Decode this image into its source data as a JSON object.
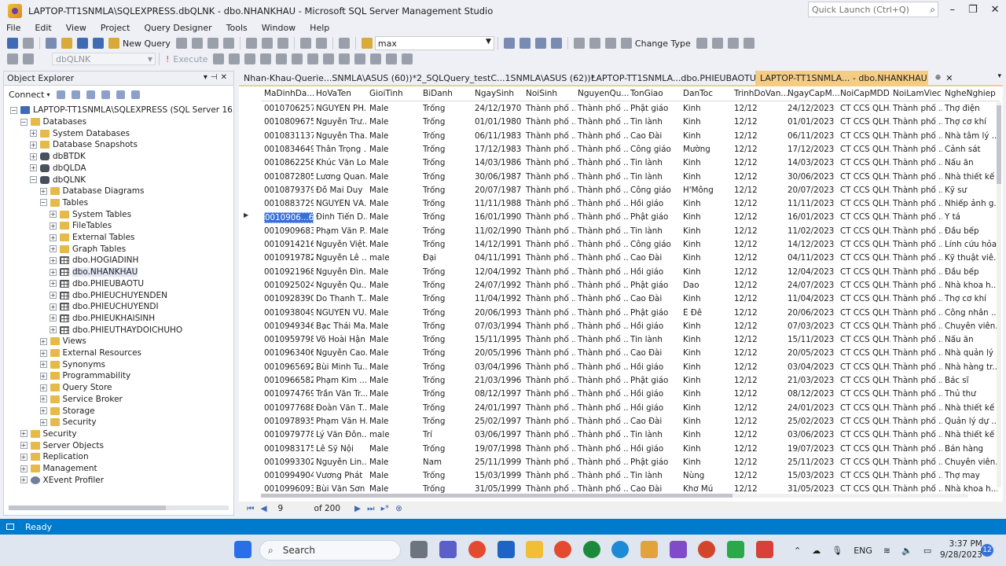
{
  "window": {
    "title": "LAPTOP-TT1SNMLA\\SQLEXPRESS.dbQLNK - dbo.NHANKHAU - Microsoft SQL Server Management Studio",
    "quick_launch_placeholder": "Quick Launch (Ctrl+Q)"
  },
  "menu": [
    "File",
    "Edit",
    "View",
    "Project",
    "Query Designer",
    "Tools",
    "Window",
    "Help"
  ],
  "toolbar": {
    "new_query": "New Query",
    "combo_value": "max",
    "change_type": "Change Type",
    "execute": "Execute",
    "db_selector": "dbQLNK"
  },
  "object_explorer": {
    "title": "Object Explorer",
    "connect": "Connect",
    "tree": [
      {
        "label": "LAPTOP-TT1SNMLA\\SQLEXPRESS (SQL Server 16.0.1000 - LA",
        "level": 0,
        "icon": "server",
        "exp": "−"
      },
      {
        "label": "Databases",
        "level": 1,
        "icon": "folder",
        "exp": "−"
      },
      {
        "label": "System Databases",
        "level": 2,
        "icon": "folder",
        "exp": "+"
      },
      {
        "label": "Database Snapshots",
        "level": 2,
        "icon": "folder",
        "exp": "+"
      },
      {
        "label": "dbBTDK",
        "level": 2,
        "icon": "db",
        "exp": "+"
      },
      {
        "label": "dbQLDA",
        "level": 2,
        "icon": "db",
        "exp": "+"
      },
      {
        "label": "dbQLNK",
        "level": 2,
        "icon": "db",
        "exp": "−"
      },
      {
        "label": "Database Diagrams",
        "level": 3,
        "icon": "folder",
        "exp": "+"
      },
      {
        "label": "Tables",
        "level": 3,
        "icon": "folder",
        "exp": "−"
      },
      {
        "label": "System Tables",
        "level": 4,
        "icon": "folder",
        "exp": "+"
      },
      {
        "label": "FileTables",
        "level": 4,
        "icon": "folder",
        "exp": "+"
      },
      {
        "label": "External Tables",
        "level": 4,
        "icon": "folder",
        "exp": "+"
      },
      {
        "label": "Graph Tables",
        "level": 4,
        "icon": "folder",
        "exp": "+"
      },
      {
        "label": "dbo.HOGIADINH",
        "level": 4,
        "icon": "table",
        "exp": "+"
      },
      {
        "label": "dbo.NHANKHAU",
        "level": 4,
        "icon": "table",
        "exp": "+",
        "selected": true
      },
      {
        "label": "dbo.PHIEUBAOTU",
        "level": 4,
        "icon": "table",
        "exp": "+"
      },
      {
        "label": "dbo.PHIEUCHUYENDEN",
        "level": 4,
        "icon": "table",
        "exp": "+"
      },
      {
        "label": "dbo.PHIEUCHUYENDI",
        "level": 4,
        "icon": "table",
        "exp": "+"
      },
      {
        "label": "dbo.PHIEUKHAISINH",
        "level": 4,
        "icon": "table",
        "exp": "+"
      },
      {
        "label": "dbo.PHIEUTHAYDOICHUHO",
        "level": 4,
        "icon": "table",
        "exp": "+"
      },
      {
        "label": "Views",
        "level": 3,
        "icon": "folder",
        "exp": "+"
      },
      {
        "label": "External Resources",
        "level": 3,
        "icon": "folder",
        "exp": "+"
      },
      {
        "label": "Synonyms",
        "level": 3,
        "icon": "folder",
        "exp": "+"
      },
      {
        "label": "Programmability",
        "level": 3,
        "icon": "folder",
        "exp": "+"
      },
      {
        "label": "Query Store",
        "level": 3,
        "icon": "folder",
        "exp": "+"
      },
      {
        "label": "Service Broker",
        "level": 3,
        "icon": "folder",
        "exp": "+"
      },
      {
        "label": "Storage",
        "level": 3,
        "icon": "folder",
        "exp": "+"
      },
      {
        "label": "Security",
        "level": 3,
        "icon": "folder",
        "exp": "+"
      },
      {
        "label": "Security",
        "level": 1,
        "icon": "folder",
        "exp": "+"
      },
      {
        "label": "Server Objects",
        "level": 1,
        "icon": "folder",
        "exp": "+"
      },
      {
        "label": "Replication",
        "level": 1,
        "icon": "folder",
        "exp": "+"
      },
      {
        "label": "Management",
        "level": 1,
        "icon": "folder",
        "exp": "+"
      },
      {
        "label": "XEvent Profiler",
        "level": 1,
        "icon": "gear",
        "exp": "+"
      }
    ]
  },
  "tabs": [
    {
      "label": "Nhan-Khau-Querie...SNMLA\\ASUS (60))*",
      "active": false
    },
    {
      "label": "2_SQLQuery_testC...1SNMLA\\ASUS (62))*",
      "active": false
    },
    {
      "label": "LAPTOP-TT1SNMLA...dbo.PHIEUBAOTU",
      "active": false
    },
    {
      "label": "LAPTOP-TT1SNMLA... - dbo.NHANKHAU",
      "active": true
    }
  ],
  "grid": {
    "columns": [
      "MaDinhDa...",
      "HoVaTen",
      "GioiTinh",
      "BiDanh",
      "NgaySinh",
      "NoiSinh",
      "NguyenQu...",
      "TonGiao",
      "DanToc",
      "TrinhDoVan...",
      "NgayCapM...",
      "NoiCapMDD",
      "NoiLamViec",
      "NgheNghiep"
    ],
    "rows": [
      [
        "0010706257...",
        "NGUYỄN PH...",
        "Male",
        "Trống",
        "24/12/1970",
        "Thành phố ...",
        "Thành phố ...",
        "Phật giáo",
        "Kinh",
        "12/12",
        "24/12/2023",
        "CT CCS QLH...",
        "Thành phố ...",
        "Thợ điện"
      ],
      [
        "0010809675...",
        "Nguyễn Trư...",
        "Male",
        "Trống",
        "01/01/1980",
        "Thành phố ...",
        "Thành phố ...",
        "Tin lành",
        "Kinh",
        "12/12",
        "01/01/2023",
        "CT CCS QLH...",
        "Thành phố ...",
        "Thợ cơ khí"
      ],
      [
        "0010831137...",
        "Nguyễn Tha...",
        "Male",
        "Trống",
        "06/11/1983",
        "Thành phố ...",
        "Thành phố ...",
        "Cao Đài",
        "Kinh",
        "12/12",
        "06/11/2023",
        "CT CCS QLH...",
        "Thành phố ...",
        "Nhà tâm lý ..."
      ],
      [
        "0010834649...",
        "Thân Trọng ...",
        "Male",
        "Trống",
        "17/12/1983",
        "Thành phố ...",
        "Thành phố ...",
        "Công giáo",
        "Mường",
        "12/12",
        "17/12/2023",
        "CT CCS QLH...",
        "Thành phố ...",
        "Cảnh sát"
      ],
      [
        "0010862258...",
        "Khúc Văn Lo...",
        "Male",
        "Trống",
        "14/03/1986",
        "Thành phố ...",
        "Thành phố ...",
        "Tin lành",
        "Kinh",
        "12/12",
        "14/03/2023",
        "CT CCS QLH...",
        "Thành phố ...",
        "Nấu ăn"
      ],
      [
        "0010872805...",
        "Lương Quan...",
        "Male",
        "Trống",
        "30/06/1987",
        "Thành phố ...",
        "Thành phố ...",
        "Tin lành",
        "Kinh",
        "12/12",
        "30/06/2023",
        "CT CCS QLH...",
        "Thành phố ...",
        "Nhà thiết kế ..."
      ],
      [
        "0010879379...",
        "Đỗ Mai Duy",
        "Male",
        "Trống",
        "20/07/1987",
        "Thành phố ...",
        "Thành phố ...",
        "Công giáo",
        "H'Mông",
        "12/12",
        "20/07/2023",
        "CT CCS QLH...",
        "Thành phố ...",
        "Kỹ sư"
      ],
      [
        "0010883729...",
        "NGUYỄN VĂ...",
        "Male",
        "Trống",
        "11/11/1988",
        "Thành phố ...",
        "Thành phố ...",
        "Hồi giáo",
        "Kinh",
        "12/12",
        "11/11/2023",
        "CT CCS QLH...",
        "Thành phố ...",
        "Nhiếp ảnh g..."
      ],
      [
        "0010906...682",
        "Đinh Tiến D...",
        "Male",
        "Trống",
        "16/01/1990",
        "Thành phố ...",
        "Thành phố ...",
        "Phật giáo",
        "Kinh",
        "12/12",
        "16/01/2023",
        "CT CCS QLH...",
        "Thành phố ...",
        "Y tá"
      ],
      [
        "0010909683...",
        "Phạm Văn P...",
        "Male",
        "Trống",
        "11/02/1990",
        "Thành phố ...",
        "Thành phố ...",
        "Tin lành",
        "Kinh",
        "12/12",
        "11/02/2023",
        "CT CCS QLH...",
        "Thành phố ...",
        "Đầu bếp"
      ],
      [
        "0010914216...",
        "Nguyễn Việt...",
        "Male",
        "Trống",
        "14/12/1991",
        "Thành phố ...",
        "Thành phố ...",
        "Công giáo",
        "Kinh",
        "12/12",
        "14/12/2023",
        "CT CCS QLH...",
        "Thành phố ...",
        "Lính cứu hỏa"
      ],
      [
        "0010919782...",
        "Nguyễn Lê ...",
        "male",
        "Đại",
        "04/11/1991",
        "Thành phố ...",
        "Thành phố ...",
        "Cao Đài",
        "Kinh",
        "12/12",
        "04/11/2023",
        "CT CCS QLH...",
        "Thành phố ...",
        "Kỹ thuật viê..."
      ],
      [
        "0010921968...",
        "Nguyễn Đìn...",
        "Male",
        "Trống",
        "12/04/1992",
        "Thành phố ...",
        "Thành phố ...",
        "Hồi giáo",
        "Kinh",
        "12/12",
        "12/04/2023",
        "CT CCS QLH...",
        "Thành phố ...",
        "Đầu bếp"
      ],
      [
        "0010925024...",
        "Nguyễn Qu...",
        "Male",
        "Trống",
        "24/07/1992",
        "Thành phố ...",
        "Thành phố ...",
        "Phật giáo",
        "Dao",
        "12/12",
        "24/07/2023",
        "CT CCS QLH...",
        "Thành phố ...",
        "Nhà khoa h..."
      ],
      [
        "0010928390...",
        "Do Thanh T...",
        "Male",
        "Trống",
        "11/04/1992",
        "Thành phố ...",
        "Thành phố ...",
        "Cao Đài",
        "Kinh",
        "12/12",
        "11/04/2023",
        "CT CCS QLH...",
        "Thành phố ...",
        "Thợ cơ khí"
      ],
      [
        "0010938049...",
        "NGUYỄN VŨ...",
        "Male",
        "Trống",
        "20/06/1993",
        "Thành phố ...",
        "Thành phố ...",
        "Phật giáo",
        "Ê Đê",
        "12/12",
        "20/06/2023",
        "CT CCS QLH...",
        "Thành phố ...",
        "Công nhân ..."
      ],
      [
        "0010949346...",
        "Bạc Thái Ma...",
        "Male",
        "Trống",
        "07/03/1994",
        "Thành phố ...",
        "Thành phố ...",
        "Hồi giáo",
        "Kinh",
        "12/12",
        "07/03/2023",
        "CT CCS QLH...",
        "Thành phố ...",
        "Chuyên viên..."
      ],
      [
        "0010959798...",
        "Võ Hoài Hận",
        "Male",
        "Trống",
        "15/11/1995",
        "Thành phố ...",
        "Thành phố ...",
        "Tin lành",
        "Kinh",
        "12/12",
        "15/11/2023",
        "CT CCS QLH...",
        "Thành phố ...",
        "Nấu ăn"
      ],
      [
        "0010963406...",
        "Nguyễn Cao...",
        "Male",
        "Trống",
        "20/05/1996",
        "Thành phố ...",
        "Thành phố ...",
        "Cao Đài",
        "Kinh",
        "12/12",
        "20/05/2023",
        "CT CCS QLH...",
        "Thành phố ...",
        "Nhà quản lý"
      ],
      [
        "0010965692...",
        "Bùi Minh Tu...",
        "Male",
        "Trống",
        "03/04/1996",
        "Thành phố ...",
        "Thành phố ...",
        "Hồi giáo",
        "Kinh",
        "12/12",
        "03/04/2023",
        "CT CCS QLH...",
        "Thành phố ...",
        "Nhà hàng tr..."
      ],
      [
        "0010966582...",
        "Phạm Kim ...",
        "Male",
        "Trống",
        "21/03/1996",
        "Thành phố ...",
        "Thành phố ...",
        "Phật giáo",
        "Kinh",
        "12/12",
        "21/03/2023",
        "CT CCS QLH...",
        "Thành phố ...",
        "Bác sĩ"
      ],
      [
        "0010974769...",
        "Trần Văn Tr...",
        "Male",
        "Trống",
        "08/12/1997",
        "Thành phố ...",
        "Thành phố ...",
        "Hồi giáo",
        "Kinh",
        "12/12",
        "08/12/2023",
        "CT CCS QLH...",
        "Thành phố ...",
        "Thủ thư"
      ],
      [
        "0010977688...",
        "Đoàn Văn T...",
        "Male",
        "Trống",
        "24/01/1997",
        "Thành phố ...",
        "Thành phố ...",
        "Hồi giáo",
        "Kinh",
        "12/12",
        "24/01/2023",
        "CT CCS QLH...",
        "Thành phố ...",
        "Nhà thiết kế ..."
      ],
      [
        "0010978935...",
        "Phạm Văn H...",
        "Male",
        "Trống",
        "25/02/1997",
        "Thành phố ...",
        "Thành phố ...",
        "Cao Đài",
        "Kinh",
        "12/12",
        "25/02/2023",
        "CT CCS QLH...",
        "Thành phố ...",
        "Quản lý dự ..."
      ],
      [
        "0010979778...",
        "Lý Văn Đôn...",
        "male",
        "Trí",
        "03/06/1997",
        "Thành phố ...",
        "Thành phố ...",
        "Tin lành",
        "Kinh",
        "12/12",
        "03/06/2023",
        "CT CCS QLH...",
        "Thành phố ...",
        "Nhà thiết kế ..."
      ],
      [
        "0010983175...",
        "Lê Sỹ Nội",
        "Male",
        "Trống",
        "19/07/1998",
        "Thành phố ...",
        "Thành phố ...",
        "Hồi giáo",
        "Kinh",
        "12/12",
        "19/07/2023",
        "CT CCS QLH...",
        "Thành phố ...",
        "Bán hàng"
      ],
      [
        "0010993302...",
        "Nguyễn Lin...",
        "Male",
        "Nam",
        "25/11/1999",
        "Thành phố ...",
        "Thành phố ...",
        "Phật giáo",
        "Kinh",
        "12/12",
        "25/11/2023",
        "CT CCS QLH...",
        "Thành phố ...",
        "Chuyên viên..."
      ],
      [
        "0010994904...",
        "Vương Phát",
        "Male",
        "Trống",
        "15/03/1999",
        "Thành phố ...",
        "Thành phố ...",
        "Tin lành",
        "Nùng",
        "12/12",
        "15/03/2023",
        "CT CCS QLH...",
        "Thành phố ...",
        "Thợ may"
      ],
      [
        "0010996093...",
        "Bùi Văn Sơn",
        "Male",
        "Trống",
        "31/05/1999",
        "Thành phố ...",
        "Thành phố ...",
        "Cao Đài",
        "Khơ Mú",
        "12/12",
        "31/05/2023",
        "CT CCS QLH...",
        "Thành phố ...",
        "Nhà khoa h..."
      ]
    ],
    "selected_row": 8,
    "nav": {
      "current_page": "9",
      "of_label": "of 200"
    }
  },
  "status": {
    "text": "Ready"
  },
  "taskbar": {
    "search_label": "Search",
    "language": "ENG",
    "time": "3:37 PM",
    "date": "9/28/2023",
    "notification_count": "12"
  }
}
